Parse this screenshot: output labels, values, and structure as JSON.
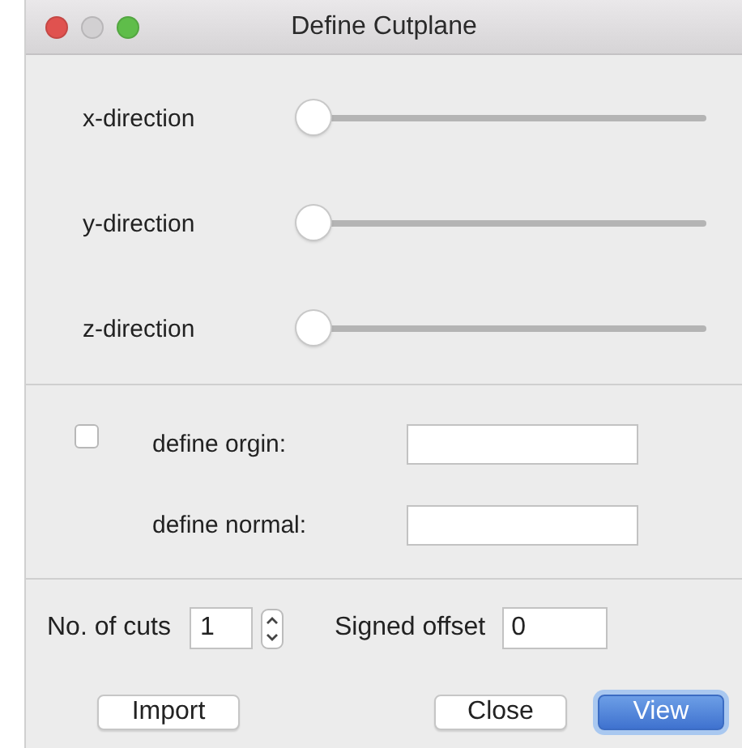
{
  "window": {
    "title": "Define Cutplane",
    "controls": [
      {
        "kind": "close",
        "disabled": false
      },
      {
        "kind": "minimize",
        "disabled": true
      },
      {
        "kind": "zoom",
        "disabled": false
      }
    ]
  },
  "sliders": [
    {
      "label": "x-direction",
      "level": 0
    },
    {
      "label": "y-direction",
      "level": 0
    },
    {
      "label": "z-direction",
      "level": 0
    }
  ],
  "custom_plane": {
    "checked": false,
    "fields": [
      {
        "label": "define orgin:"
      },
      {
        "label": "define normal:"
      }
    ]
  },
  "cuts": {
    "label": "No. of cuts",
    "value": "1"
  },
  "offset": {
    "label": "Signed offset",
    "value": "0"
  },
  "buttons": [
    {
      "label": "Import",
      "kind": "normal"
    },
    {
      "label": "Close",
      "kind": "normal"
    },
    {
      "label": "View",
      "kind": "default"
    }
  ]
}
